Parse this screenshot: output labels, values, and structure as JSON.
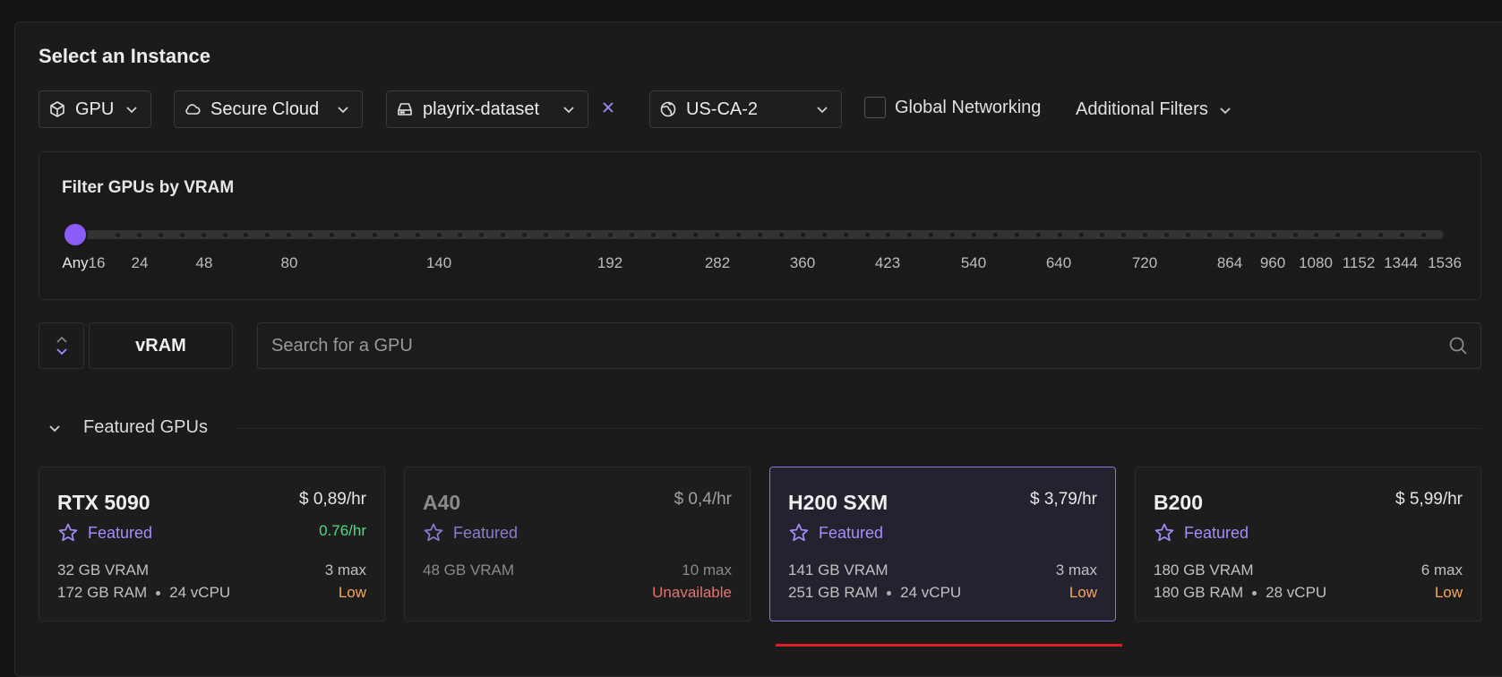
{
  "title": "Select an Instance",
  "filters": {
    "type": {
      "label": "GPU",
      "icon": "cube-icon"
    },
    "cloud": {
      "label": "Secure Cloud",
      "icon": "cloud-icon"
    },
    "volume": {
      "label": "playrix-dataset",
      "icon": "drive-icon"
    },
    "clear": "×",
    "region": {
      "label": "US-CA-2",
      "icon": "globe-icon"
    },
    "global_networking": {
      "label": "Global Networking",
      "checked": false
    },
    "additional": "Additional Filters"
  },
  "vram_filter": {
    "title": "Filter GPUs by VRAM",
    "selected": "Any",
    "ticks": [
      "Any",
      "16",
      "24",
      "48",
      "80",
      "140",
      "192",
      "282",
      "360",
      "423",
      "540",
      "640",
      "720",
      "864",
      "960",
      "1080",
      "1152",
      "1344",
      "1536"
    ]
  },
  "sort": {
    "label": "vRAM"
  },
  "search": {
    "placeholder": "Search for a GPU",
    "value": ""
  },
  "featured": {
    "label": "Featured GPUs"
  },
  "cards": [
    {
      "name": "RTX 5090",
      "price": "$ 0,89/hr",
      "alt_price": "0.76/hr",
      "badge": "Featured",
      "vram": "32 GB VRAM",
      "max": "3 max",
      "ram": "172 GB RAM",
      "vcpu": "24 vCPU",
      "status": "Low",
      "status_color": "#f5a85a"
    },
    {
      "name": "A40",
      "price": "$ 0,4/hr",
      "alt_price": "",
      "badge": "Featured",
      "vram": "48 GB VRAM",
      "max": "10 max",
      "ram": "",
      "vcpu": "",
      "status": "Unavailable",
      "status_color": "#e57373"
    },
    {
      "name": "H200 SXM",
      "price": "$ 3,79/hr",
      "alt_price": "",
      "badge": "Featured",
      "vram": "141 GB VRAM",
      "max": "3 max",
      "ram": "251 GB RAM",
      "vcpu": "24 vCPU",
      "status": "Low",
      "status_color": "#f5a85a"
    },
    {
      "name": "B200",
      "price": "$ 5,99/hr",
      "alt_price": "",
      "badge": "Featured",
      "vram": "180 GB VRAM",
      "max": "6 max",
      "ram": "180 GB RAM",
      "vcpu": "28 vCPU",
      "status": "Low",
      "status_color": "#f5a85a"
    }
  ],
  "colors": {
    "accent": "#8b5cf6",
    "selected_border": "#8b73d9",
    "warning": "#f5a85a",
    "error": "#e57373",
    "success": "#4ade80",
    "underline": "#e11d2a"
  }
}
